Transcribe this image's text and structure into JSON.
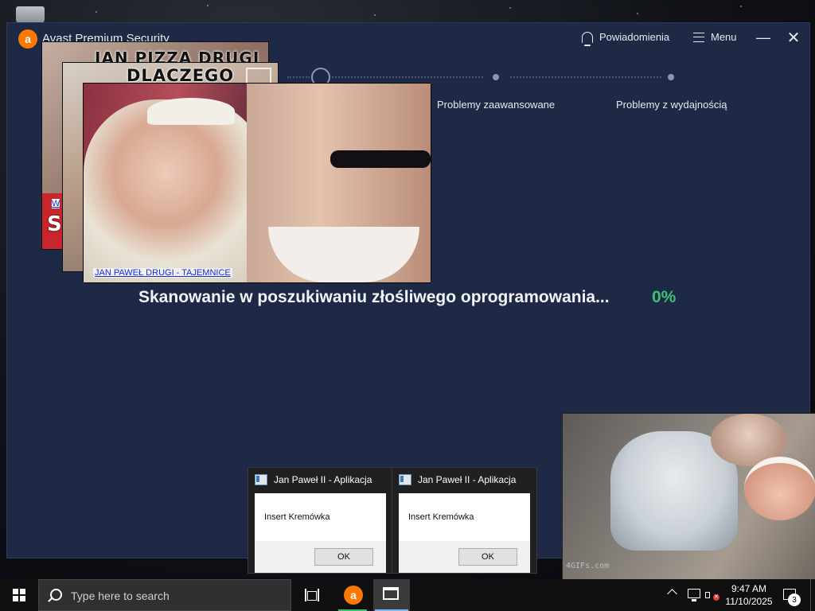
{
  "avast": {
    "title": "Avast Premium Security",
    "notifications_label": "Powiadomienia",
    "menu_label": "Menu",
    "steps": [
      "Problemy zaawansowane",
      "Problemy z wydajnością"
    ],
    "scan_text": "Skanowanie w poszukiwaniu złośliwego oprogramowania...",
    "scan_percent": "0%",
    "progress": 0,
    "colors": {
      "accent": "#ff7800",
      "window_bg": "#1e2a45",
      "percent": "#3ec270"
    }
  },
  "popups": {
    "meme1": {
      "caption": "JAN PIZZA DRUGI",
      "link": "W",
      "letters": "SL"
    },
    "meme2": {
      "caption": "DLACZEGO"
    },
    "meme3": {
      "link": "JAN PAWEŁ DRUGI - TAJEMNICE"
    },
    "meme4": {
      "watermark": "4GIFs.com"
    }
  },
  "dialogs": [
    {
      "title": "Jan Paweł II - Aplikacja",
      "message": "Insert Kremówka",
      "ok_label": "OK"
    },
    {
      "title": "Jan Paweł II - Aplikacja",
      "message": "Insert Kremówka",
      "ok_label": "OK"
    }
  ],
  "taskbar": {
    "search_placeholder": "Type here to search",
    "time": "9:47 AM",
    "date": "11/10/2025",
    "notification_count": "3"
  }
}
